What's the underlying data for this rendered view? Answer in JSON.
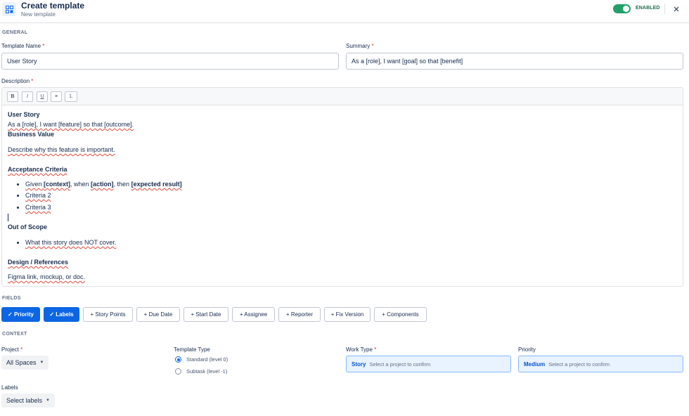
{
  "header": {
    "title": "Create template",
    "subtitle": "New template",
    "status_label": "ENABLED",
    "close_icon": "close-icon",
    "template_icon": "template-grid-icon"
  },
  "general": {
    "section_label": "GENERAL",
    "template_name_label": "Template Name",
    "template_name_value": "User Story",
    "summary_label": "Summary",
    "summary_value": "As a [role], I want [goal] so that [benefit]",
    "required_marker": "*",
    "description_label": "Description"
  },
  "toolbar": {
    "bold": "B",
    "italic": "I",
    "underline": "U",
    "bullet_list": "≡",
    "numbered_list": "1."
  },
  "description": {
    "heading_user_story": "User Story",
    "line_role": "As a [role], I want [feature] so that [outcome].",
    "heading_business_value": "Business Value",
    "line_business": "Describe why this feature is important.",
    "heading_acceptance": "Acceptance Criteria",
    "criteria_1_a": "Given ",
    "criteria_1_b": "[context]",
    "criteria_1_c": ", when ",
    "criteria_1_d": "[action]",
    "criteria_1_e": ", then ",
    "criteria_1_f": "[expected result]",
    "criteria_2": "Criteria 2",
    "criteria_3": "Criteria 3",
    "heading_out_of_scope": "Out of Scope",
    "line_out_of_scope": "What this story does NOT cover.",
    "heading_design": "Design / References",
    "line_design": "Figma link, mockup, or doc."
  },
  "fields": {
    "section_label": "FIELDS",
    "chips": [
      {
        "label": "✓ Priority",
        "selected": true
      },
      {
        "label": "✓ Labels",
        "selected": true
      },
      {
        "label": "+ Story Points",
        "selected": false
      },
      {
        "label": "+ Due Date",
        "selected": false
      },
      {
        "label": "+ Start Date",
        "selected": false
      },
      {
        "label": "+ Assignee",
        "selected": false
      },
      {
        "label": "+ Reporter",
        "selected": false
      },
      {
        "label": "+ Fix Version",
        "selected": false
      },
      {
        "label": "+ Components",
        "selected": false
      }
    ]
  },
  "context": {
    "section_label": "CONTEXT",
    "project_label": "Project",
    "project_value": "All Spaces",
    "template_type_label": "Template Type",
    "type_standard": "Standard (level 0)",
    "type_subtask": "Subtask (level -1)",
    "work_type_label": "Work Type",
    "work_type_value": "Story",
    "work_type_hint": "Select a project to confirm",
    "priority_label": "Priority",
    "priority_value": "Medium",
    "priority_hint": "Select a project to confirm",
    "labels_label": "Labels",
    "labels_value": "Select labels"
  },
  "colors": {
    "accent": "#0c66e4",
    "toggle_on": "#22a06b",
    "required": "#c9372c"
  }
}
